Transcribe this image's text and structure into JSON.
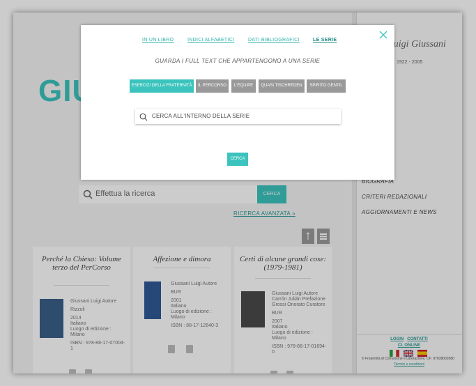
{
  "page": {
    "logo_text": "GIU",
    "signature": "Luigi Giussani",
    "years": "1922 - 2005",
    "search_placeholder": "Effettua la ricerca",
    "search_button": "CERCA",
    "advanced_search": "RICERCA AVANZATA »"
  },
  "right_menu": {
    "items": [
      "BIOGRAFIA",
      "CRITERI REDAZIONALI",
      "AGGIORNAMENTI E NEWS"
    ]
  },
  "footer": {
    "login": "LOGIN",
    "contacts": "CONTATTI",
    "online": "CL ONLINE",
    "copyright": "© Fraternità di Comunione e Liberazione, CF: 97038000580",
    "terms": "Termini e condizioni",
    "flags": [
      "Italiano",
      "English",
      "Español"
    ]
  },
  "cards": [
    {
      "title": "Perché la Chiesa: Volume terzo del PerCorso",
      "author": "Giussani Luigi Autore",
      "publisher": "Rizzoli",
      "year": "2014",
      "language": "Italiano",
      "place": "Luogo di edizione : Milano",
      "isbn": "ISBN : 978-88-17-07004-1",
      "cover_color": "#3a5f8a"
    },
    {
      "title": "Affezione e dimora",
      "author": "Giussani Luigi Autore",
      "publisher": "BUR",
      "year": "2001",
      "language": "Italiano",
      "place": "Luogo di edizione : Milano",
      "isbn": "ISBN : 88-17-12640-3",
      "cover_color": "#2f5a96"
    },
    {
      "title": "Certi di alcune grandi cose: (1979-1981)",
      "author": "Giussani Luigi Autore",
      "author2": "Carrón Julián Prefazione",
      "author3": "Grossi Onorato Curatore",
      "publisher": "BUR",
      "year": "2007",
      "language": "Italiano",
      "place": "Luogo di edizione : Milano",
      "isbn": "ISBN : 978-88-17-01694-0",
      "cover_color": "#4a4a4a"
    }
  ],
  "modal": {
    "tabs": [
      "IN UN LIBRO",
      "INDICI ALFABETICI",
      "DATI BIBLIOGRAFICI",
      "LE SERIE"
    ],
    "active_tab": "LE SERIE",
    "subtitle": "GUARDA I FULL TEXT CHE APPARTENGONO A UNA SERIE",
    "series": [
      "ESERCIZI DELLA FRATERNITÀ",
      "IL PERCORSO",
      "L'EQUIPE",
      "QUASI TISCHREDEN",
      "SPIRITO GENTIL"
    ],
    "active_series": "ESERCIZI DELLA FRATERNITÀ",
    "search_placeholder": "CERCA ALL'INTERNO DELLA SERIE",
    "submit": "CERCA"
  },
  "colors": {
    "accent": "#3bc3bd",
    "link": "#2ab0aa",
    "inactive_series": "#999999"
  }
}
